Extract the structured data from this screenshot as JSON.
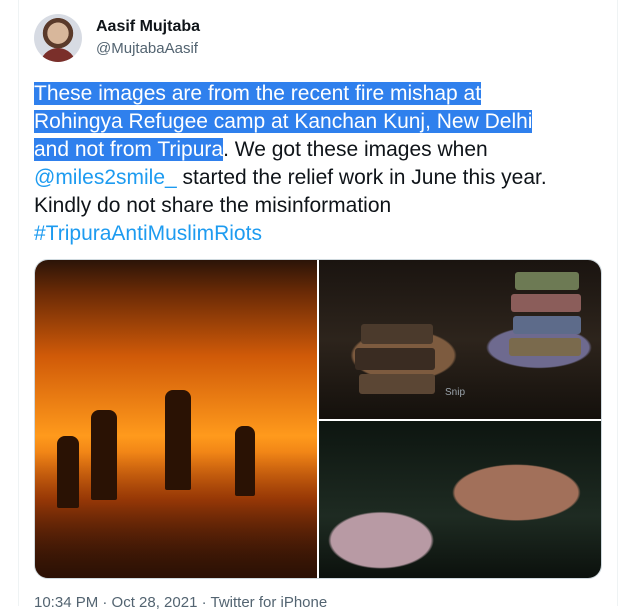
{
  "author": {
    "name": "Aasif Mujtaba",
    "handle": "@MujtabaAasif"
  },
  "tweet": {
    "highlighted_1": "These images are from the recent fire mishap at",
    "highlighted_2": "Rohingya Refugee camp at Kanchan Kunj, New Delhi",
    "highlighted_3": "and not from Tripura",
    "rest_1": ". We got these images when",
    "mention": "@miles2smile_",
    "rest_2": " started the relief work in June this year.",
    "rest_3": "Kindly do not share the misinformation",
    "hashtag": "#TripuraAntiMuslimRiots"
  },
  "media": {
    "watermark": "Snip"
  },
  "meta": {
    "timestamp": "10:34 PM · Oct 28, 2021 · Twitter for iPhone"
  },
  "colors": {
    "link": "#1d9bf0",
    "highlight": "#2f80ed"
  }
}
